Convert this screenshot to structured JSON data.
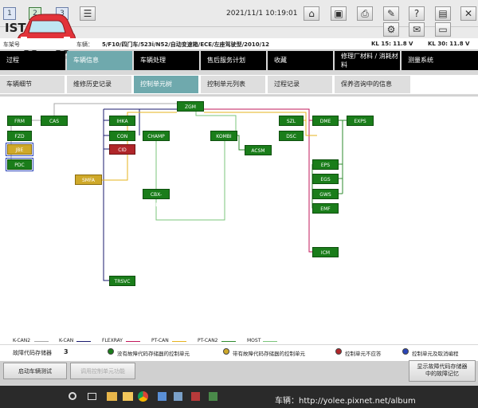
{
  "window_buttons": [
    "1",
    "2",
    "3"
  ],
  "app_title": "ISTA",
  "datetime": "2021/11/1 10:19:01",
  "icons": [
    "list-icon",
    "home-icon",
    "monitor-icon",
    "printer-icon",
    "wrench-icon",
    "help-icon",
    "photo-icon",
    "close-icon",
    "settings-icon",
    "mail-icon",
    "device-icon",
    "settings-icon",
    "mail-icon",
    "device-icon"
  ],
  "vehicle": {
    "label_frame": "车架号",
    "label_vehicle": "车辆：",
    "description": "5/F10/四门车/523i/N52/自动变速箱/ECE/左座驾驶型/2010/12",
    "kl15": "KL 15:  11.8 V",
    "kl30": "KL 30:  11.8 V"
  },
  "main_tabs": [
    "过程",
    "车辆信息",
    "车辆处理",
    "售后服务计划",
    "收藏",
    "修理厂材料 / 消耗材料",
    "测量系统"
  ],
  "sub_tabs": [
    "车辆细节",
    "维修历史记录",
    "控制单元树",
    "控制单元列表",
    "过程记录",
    "保养咨询中的信息"
  ],
  "nodes": {
    "zgm": "ZGM",
    "frm": "FRM",
    "fzd": "FZD",
    "jbe": "JBE",
    "pdc": "PDC",
    "cas": "CAS",
    "ihka": "IHKA",
    "con": "CON",
    "cid": "CID",
    "champ": "CHAMP",
    "kombi": "KOMBI",
    "acsm": "ACSM",
    "smfa": "SMFA",
    "cbx_media": "CBX-MEDIA",
    "trsvc": "TRSVC",
    "szl": "SZL",
    "dsc": "DSC",
    "dme": "DME",
    "exps": "EXPS",
    "eps": "EPS",
    "egs": "EGS",
    "gws": "GWS",
    "emf": "EMF",
    "icm": "ICM"
  },
  "bus_legend": [
    "K-CAN2",
    "K-CAN",
    "FLEXRAY",
    "PT-CAN",
    "PT-CAN2",
    "MOST"
  ],
  "bus_colors": {
    "K-CAN2": "#a8a8a8",
    "K-CAN": "#1a1a6e",
    "FLEXRAY": "#c2185b",
    "PT-CAN": "#e6b31e",
    "PT-CAN2": "#2e8b2e",
    "MOST": "#7bc47b"
  },
  "status": {
    "fault_label": "故障代码存储器",
    "fault_count": "3",
    "legend": [
      "没有故障代码存储器的控制单元",
      "带有故障代码存储器的控制单元",
      "控制单元不应答",
      "控制单元及取消编程"
    ],
    "legend_colors": [
      "#1a7d1a",
      "#cfa92a",
      "#b0262a",
      "#2b45b8"
    ]
  },
  "buttons": {
    "start_test": "启动车辆测试",
    "call_ecu": "调用控制单元功能",
    "show_fault_line1": "显示故障代码存储器",
    "show_fault_line2": "中的故障记忆"
  },
  "watermark": "车辆：http://yolee.pixnet.net/album"
}
